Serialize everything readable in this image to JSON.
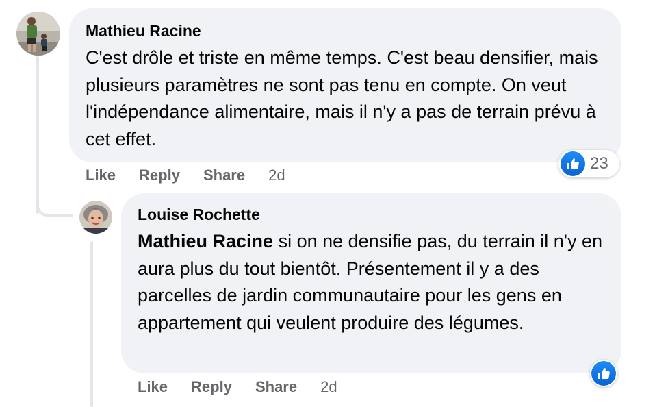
{
  "comment": {
    "author": "Mathieu Racine",
    "text": "C'est drôle et triste en même temps. C'est beau densifier, mais plusieurs paramètres ne sont pas tenu en compte. On veut l'indépendance alimentaire, mais il n'y a pas de terrain prévu à cet effet.",
    "actions": {
      "like": "Like",
      "reply": "Reply",
      "share": "Share"
    },
    "time": "2d",
    "reaction_icon": "thumbs-up-icon",
    "reaction_count": "23"
  },
  "reply": {
    "author": "Louise Rochette",
    "mention": "Mathieu Racine",
    "text": "si on ne densifie pas, du terrain il n'y en aura plus du tout bientôt. Présentement il y a des parcelles de jardin communautaire pour les gens en appartement qui veulent produire des légumes.",
    "actions": {
      "like": "Like",
      "reply": "Reply",
      "share": "Share"
    },
    "time": "2d",
    "reaction_icon": "thumbs-up-icon"
  },
  "colors": {
    "bubble": "#f0f2f5",
    "action_text": "#65676b",
    "like_blue": "#1877f2",
    "thread_line": "#e4e6eb"
  }
}
